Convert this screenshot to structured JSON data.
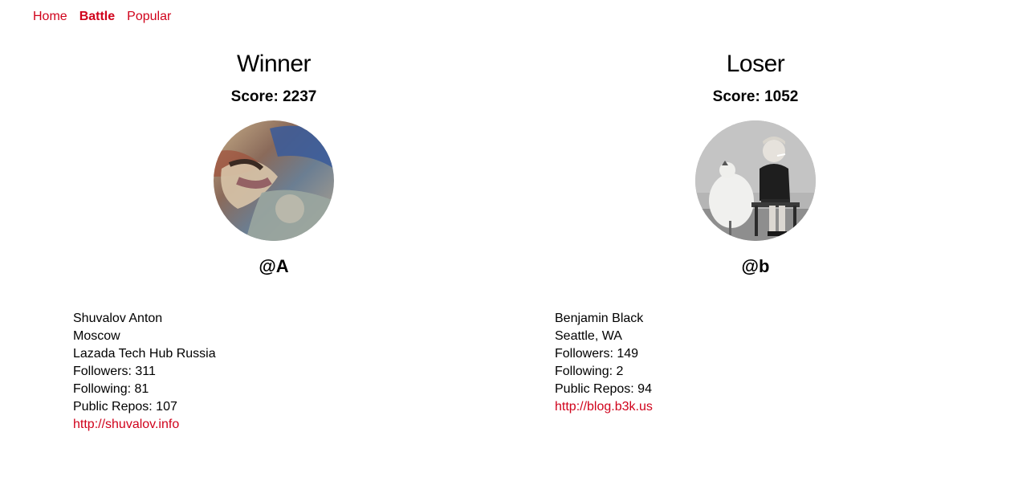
{
  "nav": {
    "home": "Home",
    "battle": "Battle",
    "popular": "Popular"
  },
  "colors": {
    "accent": "#d0021b",
    "text": "#000000",
    "background": "#ffffff"
  },
  "players": [
    {
      "result": "Winner",
      "score_text": "Score: 2237",
      "login": "@A",
      "name": "Shuvalov Anton",
      "location": "Moscow",
      "company": "Lazada Tech Hub Russia",
      "followers": "Followers: 311",
      "following": "Following: 81",
      "public_repos": "Public Repos: 107",
      "blog": "http://shuvalov.info"
    },
    {
      "result": "Loser",
      "score_text": "Score: 1052",
      "login": "@b",
      "name": "Benjamin Black",
      "location": "Seattle, WA",
      "followers": "Followers: 149",
      "following": "Following: 2",
      "public_repos": "Public Repos: 94",
      "blog": "http://blog.b3k.us"
    }
  ]
}
